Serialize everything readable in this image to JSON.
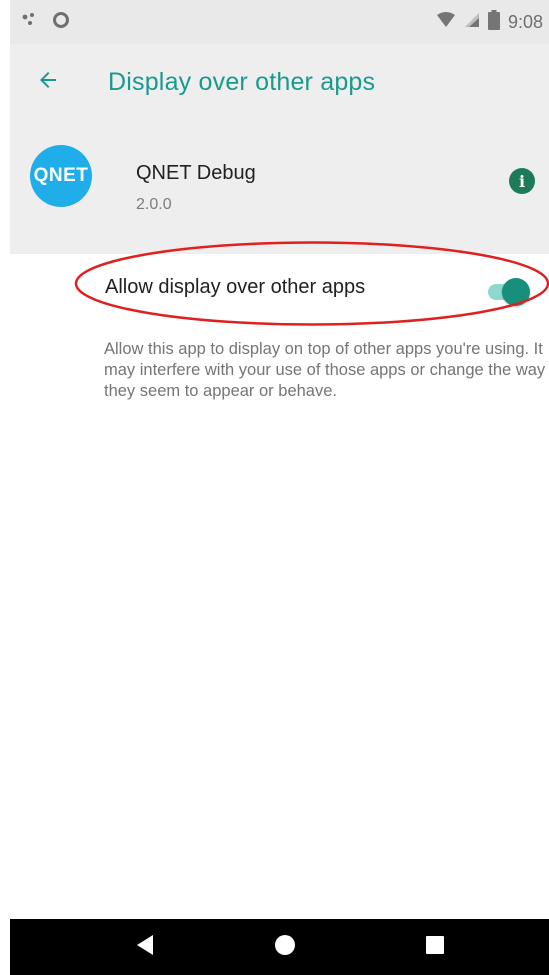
{
  "status_bar": {
    "time": "9:08",
    "icons": [
      "notification-icon",
      "circle-icon",
      "wifi-icon",
      "cellular-signal-icon",
      "battery-icon"
    ]
  },
  "app_bar": {
    "title": "Display over other apps",
    "back_icon": "arrow-left-icon",
    "accent_color": "#1a9a8c"
  },
  "app_header": {
    "icon_text": "QNET",
    "icon_color": "#1faeea",
    "name": "QNET Debug",
    "version": "2.0.0",
    "info_icon": "info-icon",
    "info_color": "#1d7b5a"
  },
  "setting": {
    "label": "Allow display over other apps",
    "enabled": true,
    "toggle_color": "#178f7b",
    "annotation_color": "#e02020"
  },
  "description": "Allow this app to display on top of other apps you're using. It may interfere with your use of those apps or change the way they seem to appear or behave.",
  "nav_bar": {
    "buttons": [
      "back-triangle-icon",
      "home-circle-icon",
      "recents-square-icon"
    ]
  }
}
